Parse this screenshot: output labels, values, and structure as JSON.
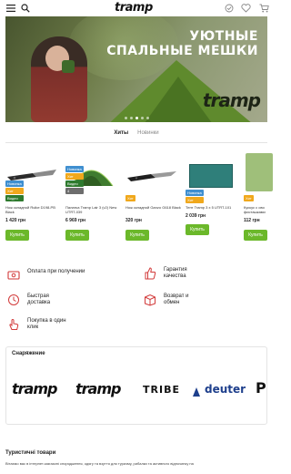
{
  "header": {
    "logo": "tramp",
    "icons": [
      "hamburger-menu-icon",
      "search-icon",
      "compare-icon",
      "heart-icon",
      "cart-icon"
    ]
  },
  "banner": {
    "title_line1": "УЮТНЫЕ",
    "title_line2": "СПАЛЬНЫЕ МЕШКИ",
    "brand": "tramp",
    "slides": 5,
    "active_slide": 3
  },
  "tabs": [
    {
      "label": "Хиты",
      "active": true
    },
    {
      "label": "Новинки",
      "active": false
    }
  ],
  "products": [
    {
      "badges": [
        "Новинка",
        "Хит",
        "Видео"
      ],
      "name": "Нож складной Ruike D198-PB Black",
      "price": "1 420 грн",
      "buy": "Купить"
    },
    {
      "badges": [
        "Новинка",
        "Хит",
        "Видео",
        "4"
      ],
      "name": "Палатка Tramp Lair 3 (v2) New UTRT-039",
      "price": "6 969 грн",
      "buy": "Купить"
    },
    {
      "badges": [
        "Хит"
      ],
      "name": "Нож складной Ganzo G618 Black",
      "price": "320 грн",
      "buy": "Купить"
    },
    {
      "badges": [
        "Новинка",
        "Хит"
      ],
      "name": "Тент Tramp 3 x 5 UTRT-101",
      "price": "2 039 грн",
      "buy": "Купить"
    },
    {
      "badges": [
        "Хит"
      ],
      "name": "Кускус с ово фисташками",
      "price": "112 грн",
      "buy": "Купить"
    }
  ],
  "features": [
    {
      "label": "Оплата при получении",
      "icon": "money-icon"
    },
    {
      "label": "Гарантия качества",
      "icon": "thumbs-up-icon"
    },
    {
      "label": "Быстрая доставка",
      "icon": "delivery-icon"
    },
    {
      "label": "Возврат и обмен",
      "icon": "return-box-icon"
    },
    {
      "label": "Покупка в один клик",
      "icon": "one-click-icon"
    }
  ],
  "brands": {
    "title": "Снаряжение",
    "items": [
      "tramp",
      "tramp",
      "TRIBE",
      "deuter",
      "P"
    ]
  },
  "bottom": {
    "title": "Туристичні товари",
    "text": "Вітаємо вас в інтернет-магазині спорядження, одягу та взуття для туризму, рибалки та активного відпочинку на"
  },
  "colors": {
    "accent_green": "#6bb82a",
    "badge_new": "#3f8fd0",
    "badge_hit": "#f0a81c",
    "badge_video": "#2e7a2e",
    "icon_red": "#d23a3a"
  }
}
